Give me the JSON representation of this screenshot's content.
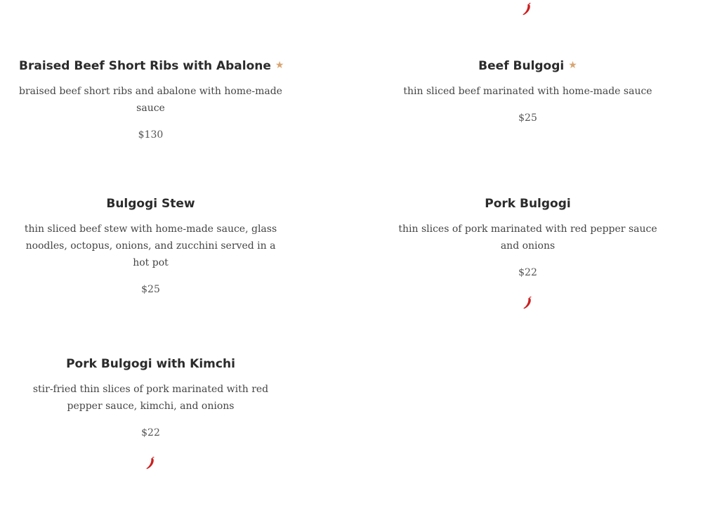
{
  "accent_color": "#d8a572",
  "spicy_color": "#cc1f1f",
  "items": [
    {
      "title": "Braised Beef Short Ribs with Abalone",
      "featured": true,
      "description": "braised beef short ribs and abalone with home-made sauce",
      "price": "$130",
      "spicy": false
    },
    {
      "title": "Beef Bulgogi",
      "featured": true,
      "description": "thin sliced beef marinated with home-made sauce",
      "price": "$25",
      "spicy": false
    },
    {
      "title": "Bulgogi Stew",
      "featured": false,
      "description": "thin sliced beef stew with home-made sauce, glass noodles, octopus, onions, and zucchini served in a hot pot",
      "price": "$25",
      "spicy": false
    },
    {
      "title": "Pork Bulgogi",
      "featured": false,
      "description": "thin slices of pork marinated with red pepper sauce and onions",
      "price": "$22",
      "spicy": true
    },
    {
      "title": "Pork Bulgogi with Kimchi",
      "featured": false,
      "description": "stir-fried thin slices of pork marinated with red pepper sauce, kimchi, and onions",
      "price": "$22",
      "spicy": true
    }
  ],
  "icons": {
    "featured": "star-icon",
    "spicy": "chili-pepper-icon"
  }
}
